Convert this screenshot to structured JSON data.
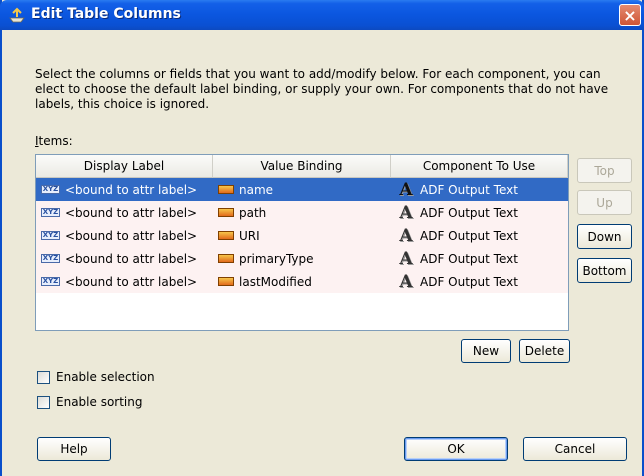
{
  "window": {
    "title": "Edit Table Columns",
    "close_label": "×"
  },
  "description": "Select the columns or fields that you want to add/modify below. For each component, you can elect to choose the default label binding, or supply your own. For components that do not have labels, this choice is ignored.",
  "items_label": {
    "mnemonic": "I",
    "rest": "tems:"
  },
  "table": {
    "headers": [
      "Display Label",
      "Value Binding",
      "Component To Use"
    ],
    "rows": [
      {
        "display_label": "<bound to attr label>",
        "value_binding": "name",
        "component": "ADF Output Text",
        "selected": true
      },
      {
        "display_label": "<bound to attr label>",
        "value_binding": "path",
        "component": "ADF Output Text",
        "selected": false
      },
      {
        "display_label": "<bound to attr label>",
        "value_binding": "URI",
        "component": "ADF Output Text",
        "selected": false
      },
      {
        "display_label": "<bound to attr label>",
        "value_binding": "primaryType",
        "component": "ADF Output Text",
        "selected": false
      },
      {
        "display_label": "<bound to attr label>",
        "value_binding": "lastModified",
        "component": "ADF Output Text",
        "selected": false
      }
    ]
  },
  "side_buttons": {
    "top": "Top",
    "up": "Up",
    "down": "Down",
    "bottom": "Bottom"
  },
  "new_label": "New",
  "delete_label": "Delete",
  "checkboxes": {
    "enable_selection": "Enable selection",
    "enable_sorting": "Enable sorting"
  },
  "footer": {
    "help": "Help",
    "ok": "OK",
    "cancel": "Cancel"
  },
  "icons": {
    "label_icon_text": "XYZ",
    "component_icon_text": "A"
  },
  "colors": {
    "titlebar": "#0a50d2",
    "selection": "#316ac5",
    "row_background": "#fdf2f2",
    "dialog_background": "#ece9d8"
  }
}
